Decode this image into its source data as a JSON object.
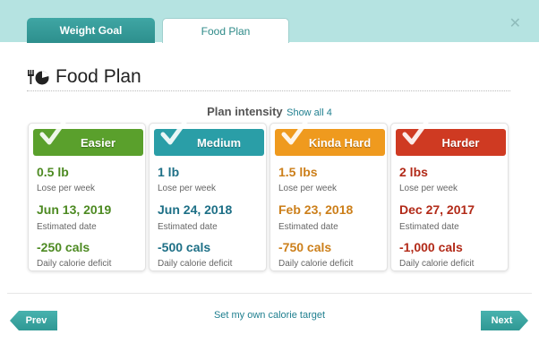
{
  "tabs": [
    {
      "label": "Weight Goal",
      "active": false
    },
    {
      "label": "Food Plan",
      "active": true
    }
  ],
  "close_icon": "close-icon",
  "title": {
    "icon": "utensils-plate-icon",
    "text": "Food Plan"
  },
  "intensity": {
    "title": "Plan intensity",
    "show_all": "Show all 4"
  },
  "plans": [
    {
      "name": "Easier",
      "color": "#5aa02c",
      "value_color": "#4d8a22",
      "loss": "0.5 lb",
      "loss_label": "Lose per week",
      "date": "Jun 13, 2019",
      "date_label": "Estimated date",
      "deficit": "-250 cals",
      "deficit_label": "Daily calorie deficit"
    },
    {
      "name": "Medium",
      "color": "#2a9ea7",
      "value_color": "#1d6f86",
      "loss": "1 lb",
      "loss_label": "Lose per week",
      "date": "Jun 24, 2018",
      "date_label": "Estimated date",
      "deficit": "-500 cals",
      "deficit_label": "Daily calorie deficit"
    },
    {
      "name": "Kinda Hard",
      "color": "#ef9a1e",
      "value_color": "#cc7f1a",
      "loss": "1.5 lbs",
      "loss_label": "Lose per week",
      "date": "Feb 23, 2018",
      "date_label": "Estimated date",
      "deficit": "-750 cals",
      "deficit_label": "Daily calorie deficit"
    },
    {
      "name": "Harder",
      "color": "#cf3a22",
      "value_color": "#b22a18",
      "loss": "2 lbs",
      "loss_label": "Lose per week",
      "date": "Dec 27, 2017",
      "date_label": "Estimated date",
      "deficit": "-1,000 cals",
      "deficit_label": "Daily calorie deficit"
    }
  ],
  "footer": {
    "prev": "Prev",
    "own_target": "Set my own calorie target",
    "next": "Next"
  }
}
